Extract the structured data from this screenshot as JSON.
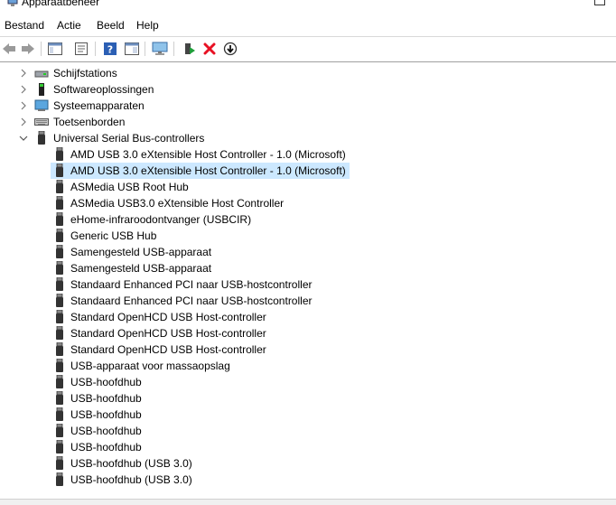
{
  "window": {
    "title": "Apparaatbeheer"
  },
  "menu": [
    "Bestand",
    "Actie",
    "Beeld",
    "Help"
  ],
  "toolbar": {
    "buttons": [
      {
        "name": "back-button",
        "icon": "arrow-left-icon"
      },
      {
        "name": "forward-button",
        "icon": "arrow-right-icon"
      },
      {
        "name": "show-hide-console-tree-button",
        "icon": "console-tree-icon"
      },
      {
        "name": "properties-button",
        "icon": "properties-icon"
      },
      {
        "name": "help-button",
        "icon": "help-icon"
      },
      {
        "name": "action-pane-button",
        "icon": "pane-icon"
      },
      {
        "name": "scan-hardware-button",
        "icon": "monitor-scan-icon"
      },
      {
        "name": "update-driver-button",
        "icon": "update-driver-icon"
      },
      {
        "name": "uninstall-device-button",
        "icon": "red-x-icon"
      },
      {
        "name": "disable-device-button",
        "icon": "down-arrow-circle-icon"
      }
    ]
  },
  "tree": {
    "categories": [
      {
        "label": "Schijfstations",
        "icon": "disk-drive-icon",
        "expanded": false
      },
      {
        "label": "Softwareoplossingen",
        "icon": "software-component-icon",
        "expanded": false
      },
      {
        "label": "Systeemapparaten",
        "icon": "system-device-icon",
        "expanded": false
      },
      {
        "label": "Toetsenborden",
        "icon": "keyboard-icon",
        "expanded": false
      },
      {
        "label": "Universal Serial Bus-controllers",
        "icon": "usb-icon",
        "expanded": true
      }
    ],
    "usb_devices": [
      "AMD USB 3.0 eXtensible Host Controller - 1.0 (Microsoft)",
      "AMD USB 3.0 eXtensible Host Controller - 1.0 (Microsoft)",
      "ASMedia USB Root Hub",
      "ASMedia USB3.0 eXtensible Host Controller",
      "eHome-infraroodontvanger (USBCIR)",
      "Generic USB Hub",
      "Samengesteld USB-apparaat",
      "Samengesteld USB-apparaat",
      "Standaard Enhanced PCI naar USB-hostcontroller",
      "Standaard Enhanced PCI naar USB-hostcontroller",
      "Standard OpenHCD USB Host-controller",
      "Standard OpenHCD USB Host-controller",
      "Standard OpenHCD USB Host-controller",
      "USB-apparaat voor massaopslag",
      "USB-hoofdhub",
      "USB-hoofdhub",
      "USB-hoofdhub",
      "USB-hoofdhub",
      "USB-hoofdhub",
      "USB-hoofdhub (USB 3.0)",
      "USB-hoofdhub (USB 3.0)"
    ],
    "selected_index": 1
  },
  "colors": {
    "selection": "#cce8ff",
    "red_x": "#e81123",
    "help_blue": "#2b5fb4"
  }
}
